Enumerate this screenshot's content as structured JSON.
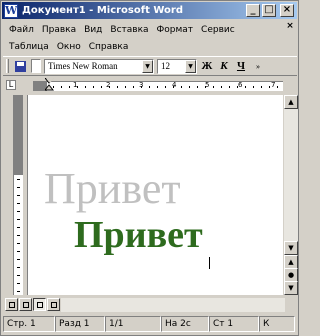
{
  "window": {
    "title": "Документ1 - Microsoft Word",
    "icon_letter": "W"
  },
  "title_buttons": {
    "minimize": "_",
    "maximize": "□",
    "close": "×"
  },
  "menu": {
    "row1": [
      "Файл",
      "Правка",
      "Вид",
      "Вставка",
      "Формат",
      "Сервис"
    ],
    "row2": [
      "Таблица",
      "Окно",
      "Справка"
    ],
    "doc_close": "×"
  },
  "toolbar": {
    "font_name": "Times New Roman",
    "font_size": "12",
    "bold_label": "Ж",
    "italic_label": "К",
    "underline_label": "Ч",
    "more_label": "»",
    "icons": [
      "save-icon",
      "dropdown-arrow-icon"
    ]
  },
  "ruler": {
    "tab_selector": "L",
    "numbers": [
      "1",
      "2",
      "3",
      "4",
      "5",
      "6",
      "7"
    ]
  },
  "document": {
    "shadow_text": "Привет",
    "main_text": "Привет",
    "main_color": "#2e6b1e",
    "shadow_color": "#c0c0c0"
  },
  "scrollbar": {
    "up": "▲",
    "down": "▼",
    "prev_page": "▲",
    "select_browse": "●",
    "next_page": "▼"
  },
  "statusbar": {
    "page": "Стр. 1",
    "section": "Разд 1",
    "page_of": "1/1",
    "position": "На 2с",
    "line": "Ст 1",
    "column": "К"
  }
}
